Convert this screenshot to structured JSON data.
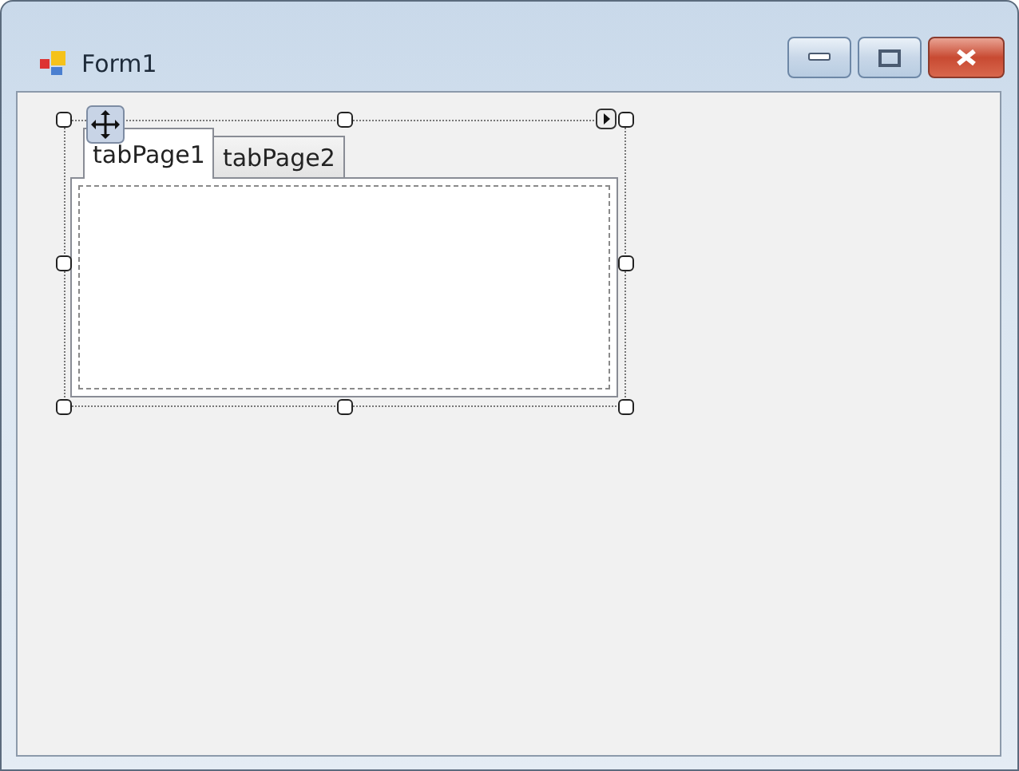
{
  "window": {
    "title": "Form1"
  },
  "tabs": [
    {
      "label": "tabPage1",
      "selected": true
    },
    {
      "label": "tabPage2",
      "selected": false
    }
  ]
}
